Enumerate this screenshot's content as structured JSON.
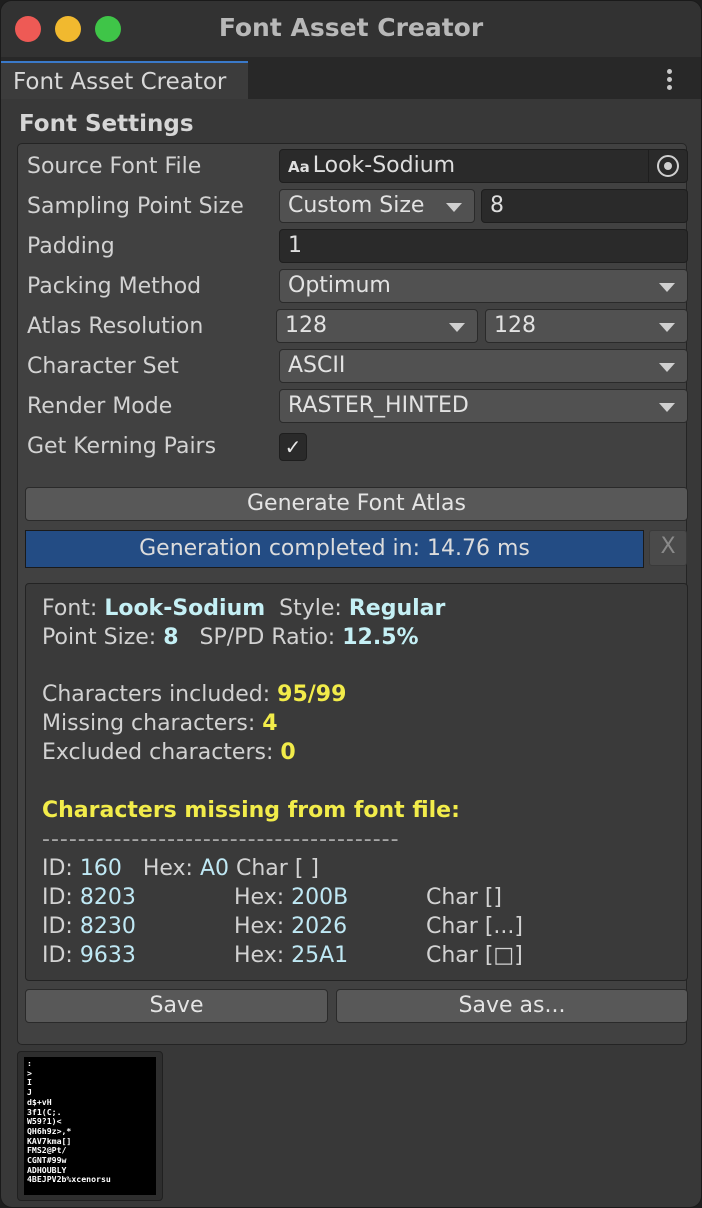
{
  "window": {
    "title": "Font Asset Creator",
    "tab_label": "Font Asset Creator"
  },
  "section_title": "Font Settings",
  "settings": {
    "source_font_label": "Source Font File",
    "source_font_icon_text": "Aa",
    "source_font_value": "Look-Sodium",
    "sampling_label": "Sampling Point Size",
    "sampling_mode": "Custom Size",
    "sampling_value": "8",
    "padding_label": "Padding",
    "padding_value": "1",
    "packing_label": "Packing Method",
    "packing_value": "Optimum",
    "atlas_label": "Atlas Resolution",
    "atlas_width": "128",
    "atlas_height": "128",
    "charset_label": "Character Set",
    "charset_value": "ASCII",
    "render_label": "Render Mode",
    "render_value": "RASTER_HINTED",
    "kerning_label": "Get Kerning Pairs",
    "kerning_checked": true
  },
  "generate_button": "Generate Font Atlas",
  "progress": {
    "text": "Generation completed in: 14.76 ms",
    "fraction": 1.0,
    "close_label": "X"
  },
  "report": {
    "font_label": "Font: ",
    "font_value": "Look-Sodium",
    "style_label": "Style: ",
    "style_value": "Regular",
    "point_size_label": "Point Size: ",
    "point_size_value": "8",
    "ratio_label": "SP/PD Ratio: ",
    "ratio_value": "12.5%",
    "included_label": "Characters included: ",
    "included_value": "95/99",
    "missing_label": "Missing characters: ",
    "missing_value": "4",
    "excluded_label": "Excluded characters: ",
    "excluded_value": "0",
    "missing_header": "Characters missing from font file:",
    "separator": "----------------------------------------",
    "id_label": "ID: ",
    "hex_label": "Hex: ",
    "missing_rows": [
      {
        "id": "160",
        "hex": "A0",
        "char": "Char [ ]"
      },
      {
        "id": "8203",
        "hex": "200B",
        "char": "Char []"
      },
      {
        "id": "8230",
        "hex": "2026",
        "char": "Char [...]"
      },
      {
        "id": "9633",
        "hex": "25A1",
        "char": "Char [□]"
      }
    ]
  },
  "save_button": "Save",
  "save_as_button": "Save as...",
  "atlas_preview_text": ":\n>\nI\nJ\nd$+vH\n3f1(C;.\nW59?1)<\nQH6h9z>,*\nKAV7kma[]\nFMS2@Pt/\nCGNT#99w\nADHOUBLY\n4BEJPV2b%xcenorsu"
}
